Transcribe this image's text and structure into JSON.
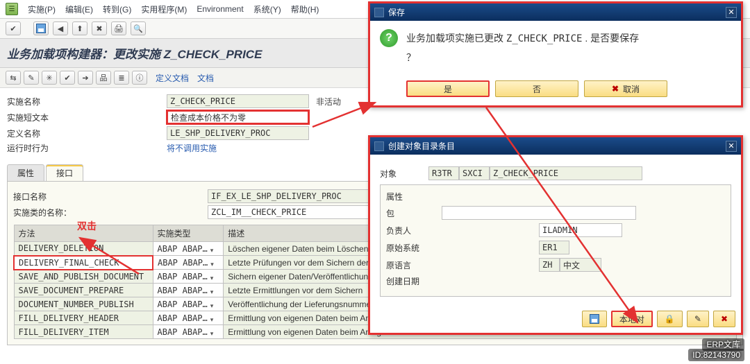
{
  "menu": {
    "edit": "实施(P)",
    "edit2": "编辑(E)",
    "goto": "转到(G)",
    "util": "实用程序(M)",
    "env": "Environment",
    "sys": "系统(Y)",
    "help": "帮助(H)"
  },
  "title": "业务加载项构建器：更改实施 Z_CHECK_PRICE",
  "toolbar2": {
    "defdoc": "定义文档",
    "doc": "文档"
  },
  "form": {
    "impl_label": "实施名称",
    "impl_value": "Z_CHECK_PRICE",
    "impl_status": "非活动",
    "short_label": "实施短文本",
    "short_value": "检查成本价格不为零",
    "def_label": "定义名称",
    "def_value": "LE_SHP_DELIVERY_PROC",
    "runtime_label": "运行时行为",
    "runtime_value": "将不调用实施"
  },
  "tabs": {
    "attr": "属性",
    "iface": "接口"
  },
  "iface": {
    "name_label": "接口名称",
    "name_value": "IF_EX_LE_SHP_DELIVERY_PROC",
    "class_label": "实施类的名称：",
    "class_value": "ZCL_IM__CHECK_PRICE",
    "dblclick": "双击",
    "col_method": "方法",
    "col_type": "实施类型",
    "col_desc": "描述",
    "rows": [
      {
        "m": "DELIVERY_DELETION",
        "t": "ABAP ABAP…",
        "d": "Löschen eigener Daten beim Löschen der L"
      },
      {
        "m": "DELIVERY_FINAL_CHECK",
        "t": "ABAP ABAP…",
        "d": "Letzte Prüfungen vor dem Sichern der Liefe"
      },
      {
        "m": "SAVE_AND_PUBLISH_DOCUMENT",
        "t": "ABAP ABAP…",
        "d": "Sichern eigener Daten/Veröffentlichung der"
      },
      {
        "m": "SAVE_DOCUMENT_PREPARE",
        "t": "ABAP ABAP…",
        "d": "Letzte Ermittlungen vor dem Sichern"
      },
      {
        "m": "DOCUMENT_NUMBER_PUBLISH",
        "t": "ABAP ABAP…",
        "d": "Veröffentlichung der Lieferungsnummer nac"
      },
      {
        "m": "FILL_DELIVERY_HEADER",
        "t": "ABAP ABAP…",
        "d": "Ermittlung von eigenen Daten beim Anleger"
      },
      {
        "m": "FILL_DELIVERY_ITEM",
        "t": "ABAP ABAP…",
        "d": "Ermittlung von eigenen Daten beim Anleger"
      }
    ]
  },
  "save_dlg": {
    "title": "保存",
    "msg1": "业务加载项实施已更改 ",
    "msg2": "Z_CHECK_PRICE",
    "msg3": " . 是否要保存",
    "msg4": "？",
    "yes": "是",
    "no": "否",
    "cancel": "取消"
  },
  "obj_dlg": {
    "title": "创建对象目录条目",
    "object_label": "对象",
    "object_v1": "R3TR",
    "object_v2": "SXCI",
    "object_v3": "Z_CHECK_PRICE",
    "attr_label": "属性",
    "pkg_label": "包",
    "owner_label": "负责人",
    "owner_value": "ILADMIN",
    "orig_label": "原始系统",
    "orig_value": "ER1",
    "lang_label": "原语言",
    "lang_code": "ZH",
    "lang_name": "中文",
    "cdate_label": "创建日期",
    "local_btn": "本地对"
  },
  "watermark": {
    "name": "ERP文库",
    "id": "ID:82143790"
  }
}
